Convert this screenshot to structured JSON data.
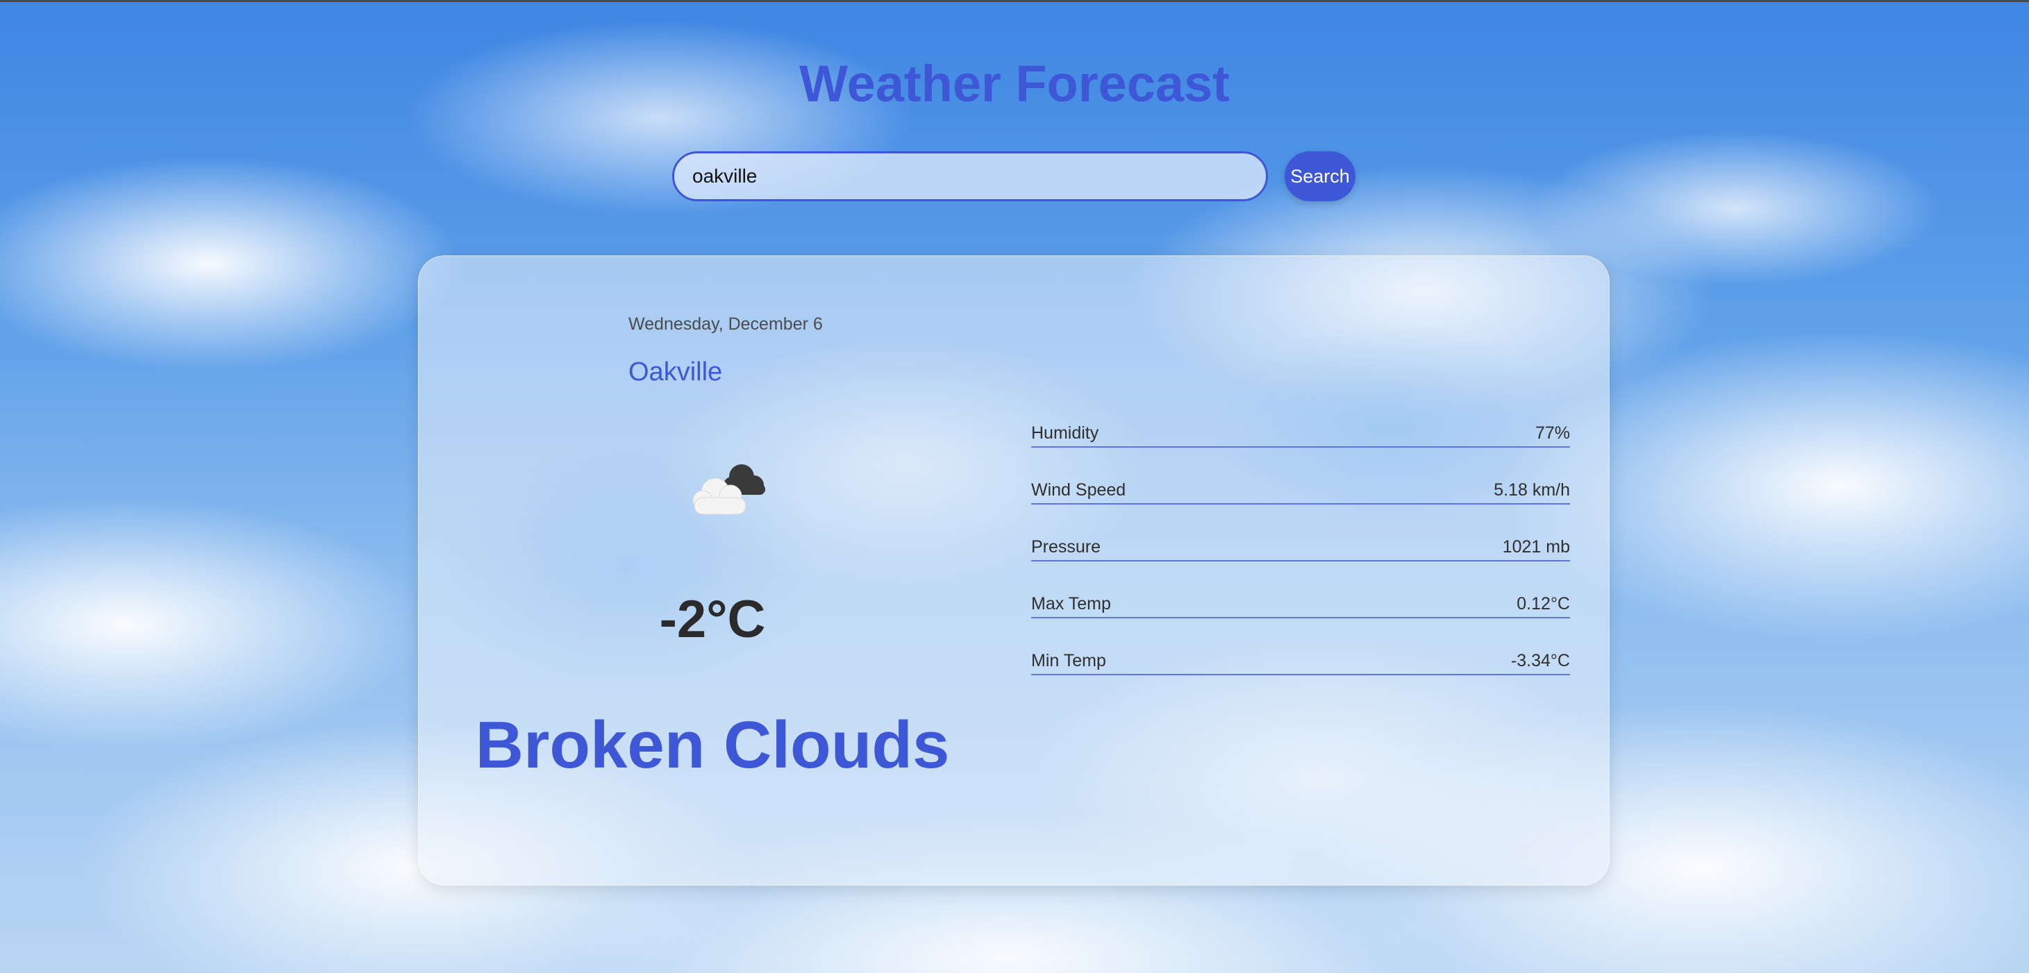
{
  "header": {
    "title": "Weather Forecast"
  },
  "search": {
    "value": "oakville",
    "button_label": "Search"
  },
  "current": {
    "date": "Wednesday, December 6",
    "city": "Oakville",
    "icon": "broken-clouds-icon",
    "temperature": "-2°C",
    "description": "Broken Clouds"
  },
  "details": [
    {
      "label": "Humidity",
      "value": "77%"
    },
    {
      "label": "Wind Speed",
      "value": "5.18 km/h"
    },
    {
      "label": "Pressure",
      "value": "1021 mb"
    },
    {
      "label": "Max Temp",
      "value": "0.12°C"
    },
    {
      "label": "Min Temp",
      "value": "-3.34°C"
    }
  ],
  "colors": {
    "accent": "#3e57d6",
    "text": "#2b2b2b"
  }
}
